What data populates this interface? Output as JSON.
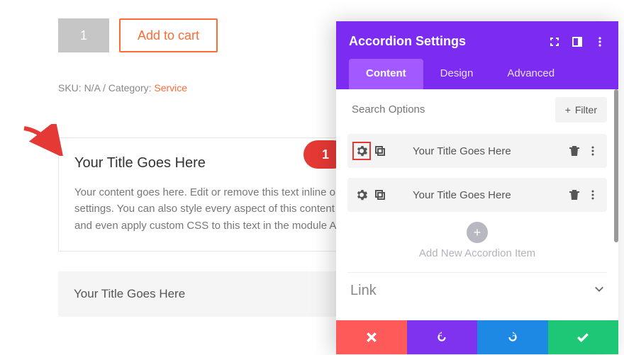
{
  "product": {
    "qty": "1",
    "add_to_cart": "Add to cart",
    "meta_prefix": "SKU: N/A / Category: ",
    "category": "Service"
  },
  "preview": {
    "card_title": "Your Title Goes Here",
    "card_body": "Your content goes here. Edit or remove this text inline or in the module Content settings. You can also style every aspect of this content in the module Design settings and even apply custom CSS to this text in the module Advanced settings.",
    "card2_title": "Your Title Goes Here"
  },
  "callout": {
    "badge": "1"
  },
  "panel": {
    "title": "Accordion Settings",
    "tabs": {
      "content": "Content",
      "design": "Design",
      "advanced": "Advanced",
      "active": "content"
    },
    "search_placeholder": "Search Options",
    "filter_label": "Filter",
    "items": [
      {
        "title": "Your Title Goes Here",
        "highlight_gear": true
      },
      {
        "title": "Your Title Goes Here",
        "highlight_gear": false
      }
    ],
    "add_label": "Add New Accordion Item",
    "section_link": "Link"
  }
}
